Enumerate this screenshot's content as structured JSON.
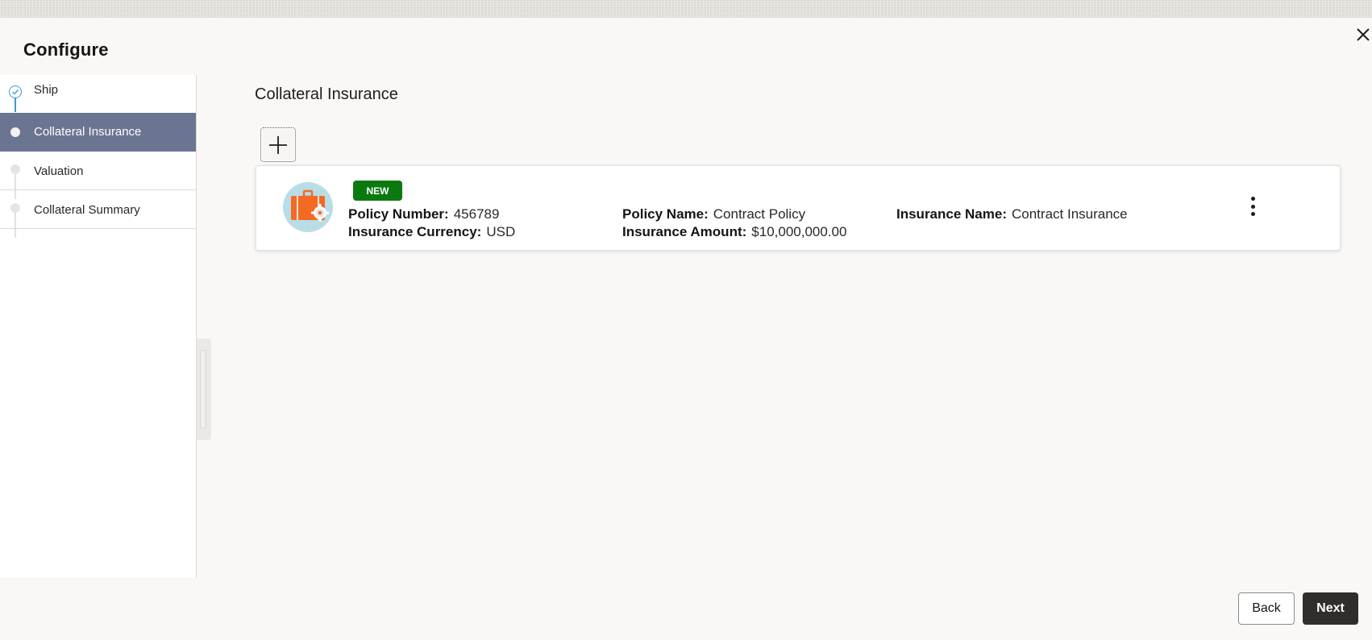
{
  "dialog": {
    "title": "Configure"
  },
  "sidebar": {
    "steps": [
      {
        "label": "Ship",
        "state": "completed"
      },
      {
        "label": "Collateral Insurance",
        "state": "active"
      },
      {
        "label": "Valuation",
        "state": "pending"
      },
      {
        "label": "Collateral Summary",
        "state": "pending"
      }
    ]
  },
  "main": {
    "section_title": "Collateral Insurance",
    "add_icon": "plus-icon",
    "card": {
      "icon": "briefcase-gear-icon",
      "badge": "NEW",
      "policy_number_label": "Policy Number:",
      "policy_number_value": "456789",
      "insurance_currency_label": "Insurance Currency:",
      "insurance_currency_value": "USD",
      "policy_name_label": "Policy Name:",
      "policy_name_value": "Contract Policy",
      "insurance_amount_label": "Insurance Amount:",
      "insurance_amount_value": "$10,000,000.00",
      "insurance_name_label": "Insurance Name:",
      "insurance_name_value": "Contract Insurance",
      "menu_icon": "more-vertical-icon"
    }
  },
  "footer": {
    "back_label": "Back",
    "next_label": "Next"
  },
  "colors": {
    "active_step": "#6b7591",
    "badge_new": "#0a7a10",
    "primary_button": "#312d2a",
    "step_check": "#3b9bd6"
  }
}
